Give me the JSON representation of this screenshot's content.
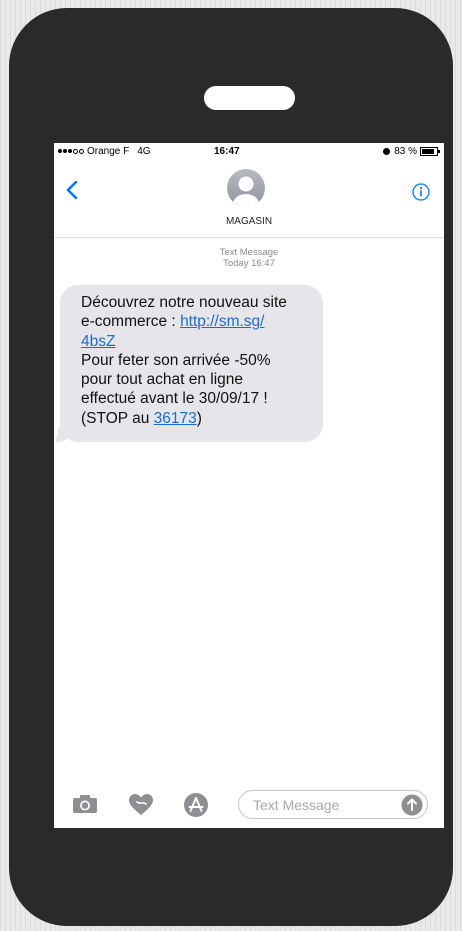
{
  "status_bar": {
    "carrier": "Orange F",
    "network": "4G",
    "time": "16:47",
    "battery": "83 %",
    "battery_level": 0.83
  },
  "header": {
    "contact_name": "MAGASIN",
    "back_icon": "chevron-left-icon",
    "info_icon": "info-icon",
    "avatar_icon": "person-silhouette-icon"
  },
  "thread": {
    "label": "Text Message",
    "timestamp": "Today 16:47"
  },
  "message": {
    "line1": "Découvrez notre nouveau site",
    "line2_prefix": "e-commerce : ",
    "link_part1": "http://sm.sg/",
    "link_part2": "4bsZ",
    "line4": "Pour feter son arrivée -50%",
    "line5": "pour tout achat en ligne",
    "line6": "effectué avant le 30/09/17 !",
    "line7_prefix": "(STOP au ",
    "stop_number": "36173",
    "line7_suffix": ")"
  },
  "compose": {
    "placeholder": "Text Message",
    "icons": [
      "camera-icon",
      "digital-touch-heart-icon",
      "app-store-icon",
      "send-arrow-icon"
    ]
  },
  "colors": {
    "phone_body": "#2a2a2a",
    "ios_blue": "#007aff",
    "bubble": "#e5e5ea",
    "link": "#1a6dd8"
  }
}
